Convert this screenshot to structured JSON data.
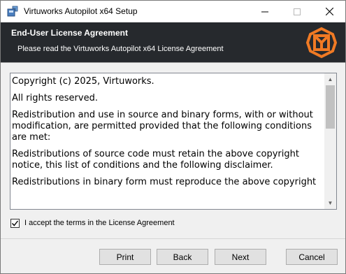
{
  "window": {
    "title": "Virtuworks Autopilot x64 Setup",
    "controls": {
      "minimize": "—",
      "close": "✕"
    }
  },
  "banner": {
    "title": "End-User License Agreement",
    "subtitle": "Please read the Virtuworks Autopilot x64 License Agreement",
    "logo_icon": "virtuworks-logo-icon",
    "accent_color": "#f07a24"
  },
  "license": {
    "paragraphs": [
      "Copyright (c) 2025, Virtuworks.",
      "All rights reserved.",
      "Redistribution and use in source and binary forms, with or without modification, are permitted provided that the following conditions are met:",
      "Redistributions of source code must retain the above copyright notice, this list of conditions and the following disclaimer.",
      "Redistributions in binary form  must  reproduce the  above  copyright"
    ]
  },
  "accept": {
    "label": "I accept the terms in the License Agreement",
    "checked": true
  },
  "buttons": {
    "print": "Print",
    "back": "Back",
    "next": "Next",
    "cancel": "Cancel"
  }
}
